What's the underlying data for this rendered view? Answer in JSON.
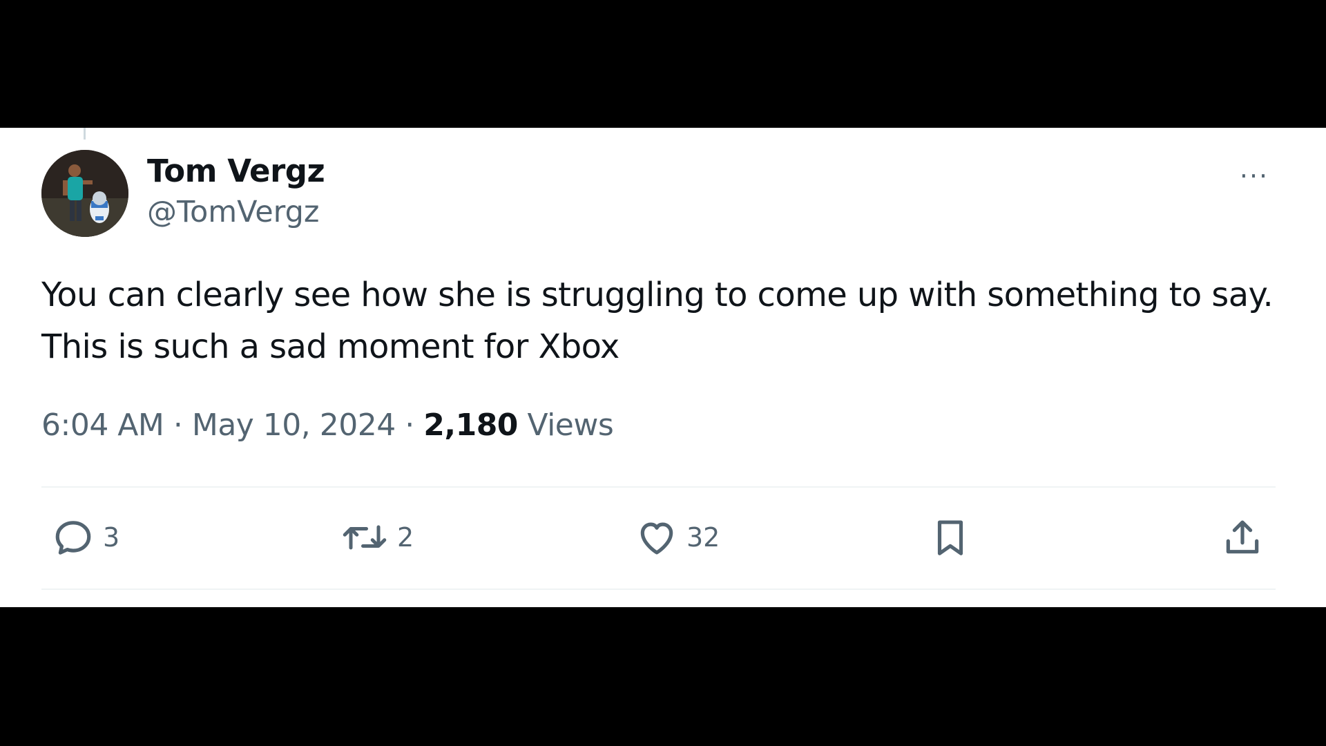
{
  "tweet": {
    "author_name": "Tom Vergz",
    "author_handle": "@TomVergz",
    "text": "You can clearly see how she is struggling to come up with something to say. This is such a sad moment for Xbox",
    "time": "6:04 AM",
    "separator": "·",
    "date": "May 10, 2024",
    "views_count": "2,180",
    "views_label": "Views",
    "more_glyph": "···"
  },
  "actions": {
    "reply_count": "3",
    "retweet_count": "2",
    "like_count": "32"
  },
  "icons": {
    "reply": "reply-icon",
    "retweet": "retweet-icon",
    "like": "heart-icon",
    "bookmark": "bookmark-icon",
    "share": "share-icon",
    "more": "more-icon"
  },
  "colors": {
    "background": "#000000",
    "card": "#ffffff",
    "primary_text": "#0f1419",
    "secondary_text": "#536471",
    "divider": "#eff3f4"
  }
}
